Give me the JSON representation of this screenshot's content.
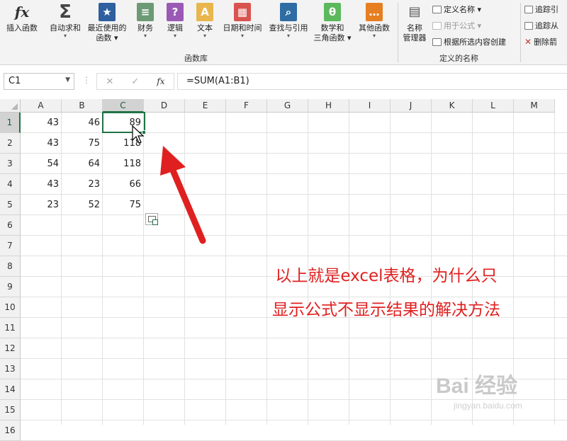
{
  "ribbon": {
    "buttons": [
      {
        "label1": "插入函数",
        "label2": "",
        "icon": "fx-icon"
      },
      {
        "label1": "自动求和",
        "label2": "▾",
        "icon": "sigma-icon"
      },
      {
        "label1": "最近使用的",
        "label2": "函数 ▾",
        "icon": "star-icon"
      },
      {
        "label1": "财务",
        "label2": "▾",
        "icon": "coins-icon"
      },
      {
        "label1": "逻辑",
        "label2": "▾",
        "icon": "question-icon"
      },
      {
        "label1": "文本",
        "label2": "▾",
        "icon": "text-a-icon"
      },
      {
        "label1": "日期和时间",
        "label2": "▾",
        "icon": "calendar-icon"
      },
      {
        "label1": "查找与引用",
        "label2": "▾",
        "icon": "lookup-icon"
      },
      {
        "label1": "数学和",
        "label2": "三角函数 ▾",
        "icon": "theta-icon"
      },
      {
        "label1": "其他函数",
        "label2": "▾",
        "icon": "more-functions-icon"
      }
    ],
    "library_group": "函数库",
    "name_manager": {
      "label1": "名称",
      "label2": "管理器"
    },
    "define_name": "定义名称 ▾",
    "use_in_formula": "用于公式 ▾",
    "create_from_selection": "根据所选内容创建",
    "names_group": "定义的名称",
    "trace_precedents": "追踪引",
    "trace_dependents": "追踪从",
    "remove_arrows": "删除箭"
  },
  "formula_bar": {
    "name_box": "C1",
    "cancel": "✕",
    "enter": "✓",
    "fx": "fx",
    "formula": "=SUM(A1:B1)"
  },
  "columns": [
    "A",
    "B",
    "C",
    "D",
    "E",
    "F",
    "G",
    "H",
    "I",
    "J",
    "K",
    "L",
    "M"
  ],
  "rows": [
    "1",
    "2",
    "3",
    "4",
    "5",
    "6",
    "7",
    "8",
    "9",
    "10",
    "11",
    "12",
    "13",
    "14",
    "15",
    "16"
  ],
  "cells": [
    [
      "43",
      "46",
      "89"
    ],
    [
      "43",
      "75",
      "118"
    ],
    [
      "54",
      "64",
      "118"
    ],
    [
      "43",
      "23",
      "66"
    ],
    [
      "23",
      "52",
      "75"
    ]
  ],
  "annotation": {
    "line1": "以上就是excel表格，为什么只",
    "line2": "显示公式不显示结果的解决方法"
  },
  "watermark": {
    "text": "Bai 经验",
    "sub": "jingyan.baidu.com"
  },
  "colors": {
    "accent": "#217346",
    "arrow": "#e02020"
  }
}
